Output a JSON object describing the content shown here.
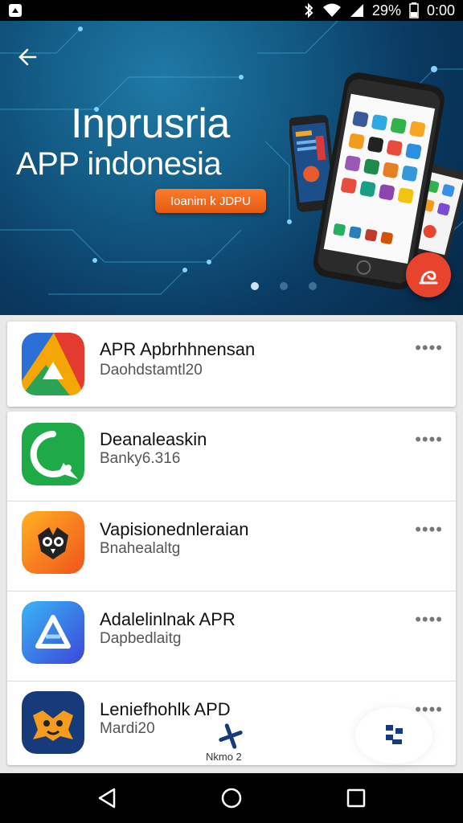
{
  "status_bar": {
    "battery": "29%",
    "time": "0:00",
    "icons": [
      "notification-icon",
      "bluetooth-icon",
      "wifi-icon",
      "signal-icon",
      "battery-icon"
    ]
  },
  "hero": {
    "title_line1": "Inprusria",
    "title_line2": "APP indonesia",
    "cta_label": "Ioanim k JDPU",
    "carousel_dots": 3,
    "active_dot": 0,
    "colors": {
      "background": "#0f4f7a",
      "cta": "#f06a1c",
      "fab": "#e8432d"
    }
  },
  "apps": [
    {
      "name": "APR Apbrhhnensan",
      "sub": "Daohdstamtl20",
      "icon": "triangle-logo-icon",
      "menu": "••••"
    },
    {
      "name": "Deanaleaskin",
      "sub": "Banky6.316",
      "icon": "chat-logo-icon",
      "menu": "••••"
    },
    {
      "name": "Vapisionednleraian",
      "sub": "Bnahealaltg",
      "icon": "bird-logo-icon",
      "menu": "••••"
    },
    {
      "name": "Adalelinlnak APR",
      "sub": "Dapbedlaitg",
      "icon": "prism-logo-icon",
      "menu": "••••"
    },
    {
      "name": "Leniefhohlk APD",
      "sub": "Mardi20",
      "icon": "mascot-logo-icon",
      "menu": "••••"
    }
  ],
  "bottom": {
    "fab_label": "Nkmo 2"
  },
  "nav": [
    "back-icon",
    "home-icon",
    "recents-icon"
  ]
}
